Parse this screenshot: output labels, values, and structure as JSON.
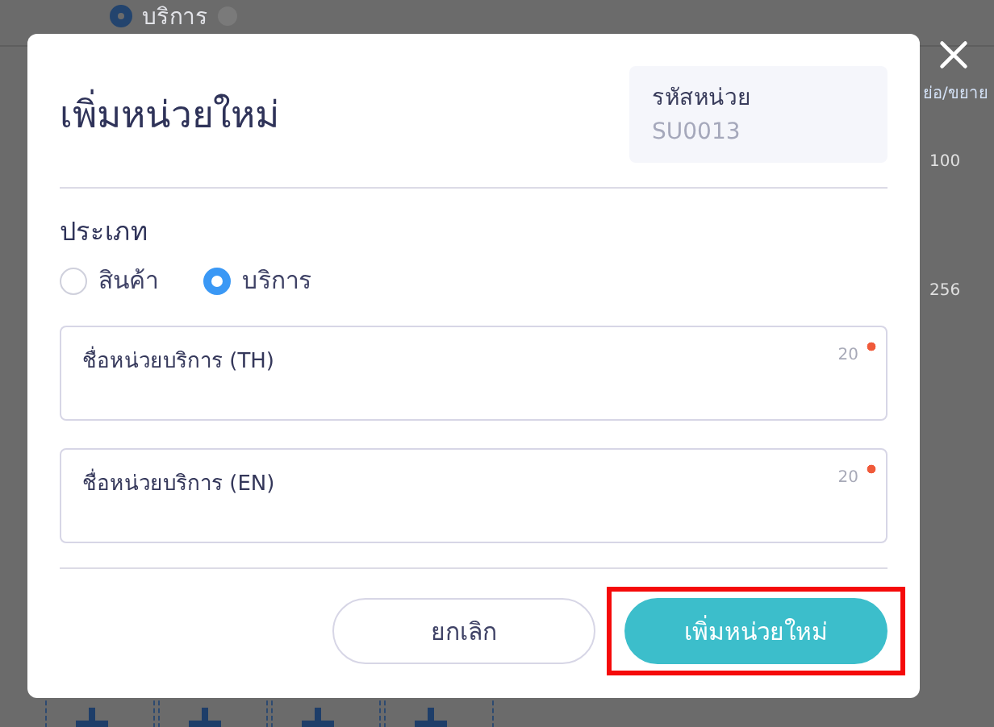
{
  "background": {
    "type_options": [
      {
        "label": "บริการ",
        "selected": true
      }
    ],
    "toggle_link": "ย่อ/ขยาย",
    "counts": [
      "100",
      "256"
    ]
  },
  "dialog": {
    "title": "เพิ่มหน่วยใหม่",
    "code": {
      "label": "รหัสหน่วย",
      "value": "SU0013"
    },
    "type_label": "ประเภท",
    "type_options": [
      {
        "label": "สินค้า",
        "selected": false
      },
      {
        "label": "บริการ",
        "selected": true
      }
    ],
    "fields": [
      {
        "placeholder": "ชื่อหน่วยบริการ (TH)",
        "counter": "20",
        "required": true
      },
      {
        "placeholder": "ชื่อหน่วยบริการ (EN)",
        "counter": "20",
        "required": true
      }
    ],
    "buttons": [
      {
        "label": "ยกเลิก",
        "kind": "secondary",
        "highlighted": false
      },
      {
        "label": "เพิ่มหน่วยใหม่",
        "kind": "primary",
        "highlighted": true
      }
    ]
  }
}
